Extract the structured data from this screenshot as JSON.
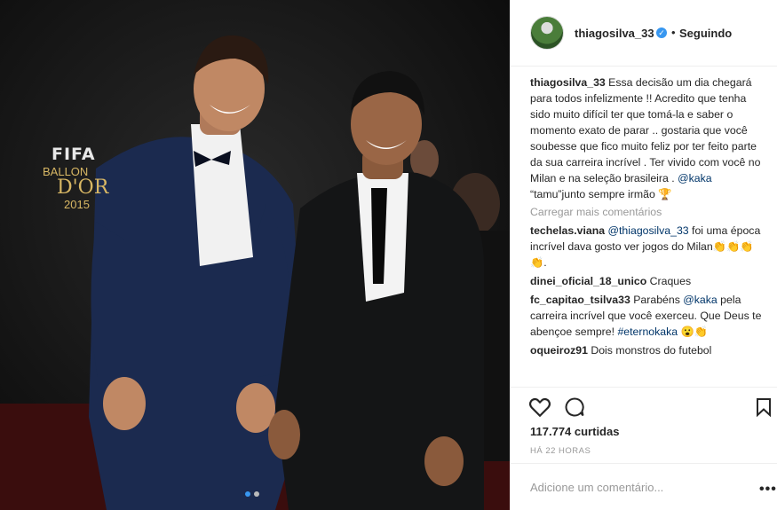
{
  "photo": {
    "logo": {
      "fifa": "FIFA",
      "ballon": "BALLON",
      "dor": "D'OR",
      "year": "2015"
    },
    "carousel": {
      "count": 2,
      "active": 0
    }
  },
  "post": {
    "username": "thiagosilva_33",
    "follow_status": "Seguindo",
    "caption": {
      "user": "thiagosilva_33",
      "text_1": " Essa decisão um dia chegará para todos infelizmente !! Acredito que tenha sido muito difícil ter que tomá-la e saber o momento exato de parar .. gostaria que você soubesse que fico muito feliz por ter feito parte da sua carreira incrível . Ter vivido com você no Milan e na seleção brasileira . ",
      "mention": "@kaka",
      "text_2": " “tamu”junto sempre irmão 🏆"
    },
    "load_more": "Carregar mais comentários",
    "comments": [
      {
        "user": "techelas.viana",
        "mention": "@thiagosilva_33",
        "text": " foi uma época incrível dava gosto ver jogos do Milan👏👏👏👏."
      },
      {
        "user": "dinei_oficial_18_unico",
        "mention": "",
        "text": " Craques"
      },
      {
        "user": "fc_capitao_tsilva33",
        "mention": "",
        "text": " Parabéns ",
        "mention2": "@kaka",
        "text2": " pela carreira incrível que você exerceu. Que Deus te abençoe sempre! ",
        "tag": "#eternokaka",
        "text3": " 😮👏"
      },
      {
        "user": "oqueiroz91",
        "mention": "",
        "text": " Dois monstros do futebol"
      }
    ],
    "likes": "117.774 curtidas",
    "time": "HÁ 22 HORAS",
    "add_comment_placeholder": "Adicione um comentário...",
    "icons": {
      "like": "heart-icon",
      "comment": "comment-icon",
      "save": "bookmark-icon",
      "more": "more-options-icon",
      "verified": "verified-badge-icon"
    },
    "colors": {
      "link": "#003569",
      "verified": "#3897f0",
      "muted": "#999999"
    }
  }
}
